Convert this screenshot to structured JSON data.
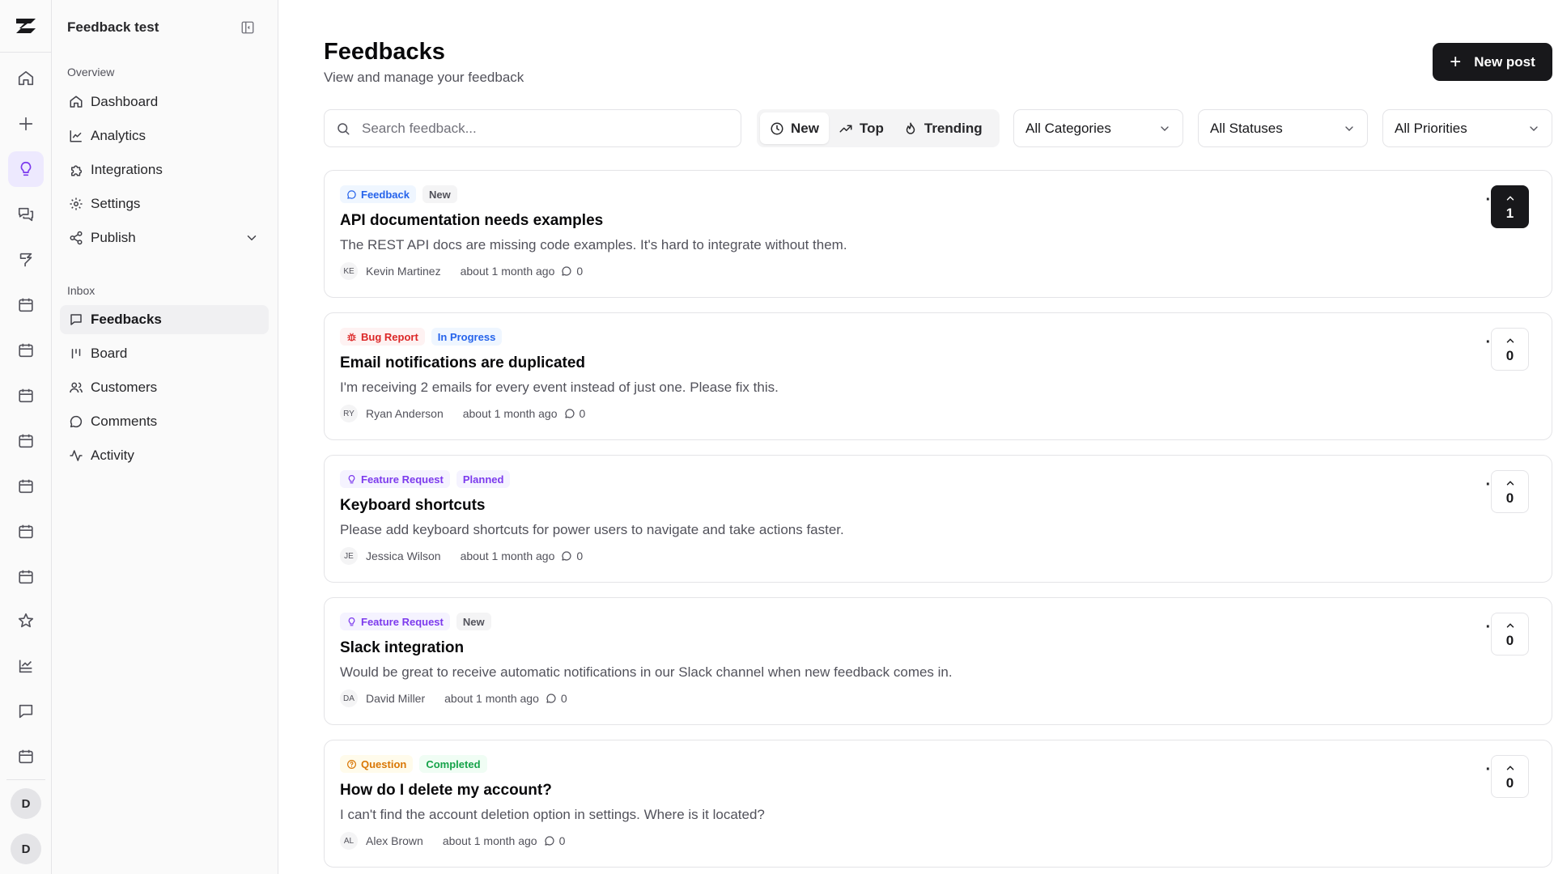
{
  "workspace": {
    "name": "Feedback test"
  },
  "rail": {
    "avatars": [
      "D",
      "D"
    ]
  },
  "sidebar": {
    "overview_label": "Overview",
    "overview_items": [
      {
        "label": "Dashboard",
        "icon": "home-icon"
      },
      {
        "label": "Analytics",
        "icon": "chart-line-icon"
      },
      {
        "label": "Integrations",
        "icon": "puzzle-icon"
      },
      {
        "label": "Settings",
        "icon": "gear-icon"
      },
      {
        "label": "Publish",
        "icon": "share-icon"
      }
    ],
    "inbox_label": "Inbox",
    "inbox_items": [
      {
        "label": "Feedbacks",
        "icon": "message-square-icon",
        "active": true
      },
      {
        "label": "Board",
        "icon": "kanban-icon"
      },
      {
        "label": "Customers",
        "icon": "users-icon"
      },
      {
        "label": "Comments",
        "icon": "message-circle-icon"
      },
      {
        "label": "Activity",
        "icon": "activity-icon"
      }
    ]
  },
  "header": {
    "title": "Feedbacks",
    "subtitle": "View and manage your feedback",
    "new_post_label": "New post"
  },
  "toolbar": {
    "search_placeholder": "Search feedback...",
    "sort": [
      {
        "label": "New",
        "icon": "clock-icon",
        "active": true
      },
      {
        "label": "Top",
        "icon": "trending-up-icon"
      },
      {
        "label": "Trending",
        "icon": "flame-icon"
      }
    ],
    "category_filter": "All Categories",
    "status_filter": "All Statuses",
    "priority_filter": "All Priorities"
  },
  "colors": {
    "feedback": "#2563eb",
    "bug": "#dc2626",
    "feature": "#7c3aed",
    "question": "#d97706",
    "completed": "#16a34a"
  },
  "posts": [
    {
      "category": "Feedback",
      "category_icon": "message-circle-icon",
      "status": "New",
      "title": "API documentation needs examples",
      "description": "The REST API docs are missing code examples. It's hard to integrate without them.",
      "author_initials": "KE",
      "author": "Kevin Martinez",
      "time": "about 1 month ago",
      "comments": "0",
      "votes": "1",
      "voted": true
    },
    {
      "category": "Bug Report",
      "category_icon": "bug-icon",
      "status": "In Progress",
      "title": "Email notifications are duplicated",
      "description": "I'm receiving 2 emails for every event instead of just one. Please fix this.",
      "author_initials": "RY",
      "author": "Ryan Anderson",
      "time": "about 1 month ago",
      "comments": "0",
      "votes": "0",
      "voted": false
    },
    {
      "category": "Feature Request",
      "category_icon": "lightbulb-icon",
      "status": "Planned",
      "title": "Keyboard shortcuts",
      "description": "Please add keyboard shortcuts for power users to navigate and take actions faster.",
      "author_initials": "JE",
      "author": "Jessica Wilson",
      "time": "about 1 month ago",
      "comments": "0",
      "votes": "0",
      "voted": false
    },
    {
      "category": "Feature Request",
      "category_icon": "lightbulb-icon",
      "status": "New",
      "title": "Slack integration",
      "description": "Would be great to receive automatic notifications in our Slack channel when new feedback comes in.",
      "author_initials": "DA",
      "author": "David Miller",
      "time": "about 1 month ago",
      "comments": "0",
      "votes": "0",
      "voted": false
    },
    {
      "category": "Question",
      "category_icon": "help-circle-icon",
      "status": "Completed",
      "title": "How do I delete my account?",
      "description": "I can't find the account deletion option in settings. Where is it located?",
      "author_initials": "AL",
      "author": "Alex Brown",
      "time": "about 1 month ago",
      "comments": "0",
      "votes": "0",
      "voted": false
    }
  ]
}
